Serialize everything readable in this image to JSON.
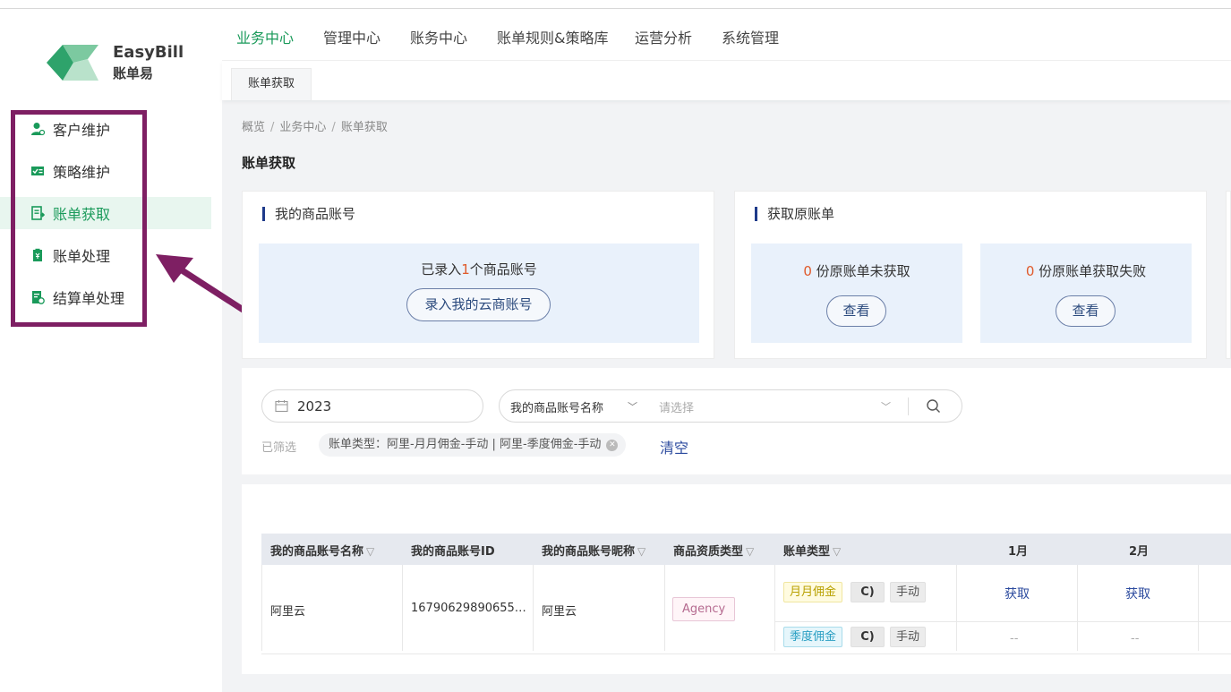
{
  "brand": {
    "name_en": "EasyBill",
    "name_cn": "账单易",
    "accent": "#1a9a5a",
    "highlight": "#7e1f63"
  },
  "sidebar": {
    "items": [
      {
        "label": "客户维护",
        "icon": "user-icon"
      },
      {
        "label": "策略维护",
        "icon": "strategy-icon"
      },
      {
        "label": "账单获取",
        "icon": "bill-fetch-icon",
        "active": true
      },
      {
        "label": "账单处理",
        "icon": "bill-process-icon"
      },
      {
        "label": "结算单处理",
        "icon": "settlement-icon"
      }
    ]
  },
  "topnav": {
    "items": [
      "业务中心",
      "管理中心",
      "账务中心",
      "账单规则&策略库",
      "运营分析",
      "系统管理"
    ],
    "active": 0
  },
  "tabs": [
    "账单获取"
  ],
  "breadcrumb": [
    "概览",
    "业务中心",
    "账单获取"
  ],
  "breadcrumb_sep": "/",
  "page_title": "账单获取",
  "cards": {
    "accounts": {
      "title": "我的商品账号",
      "text_pre": "已录入",
      "count": "1",
      "text_post": "个商品账号",
      "button": "录入我的云商账号"
    },
    "raw_bills": {
      "title": "获取原账单",
      "not_fetched_count": "0",
      "not_fetched_text": " 份原账单未获取",
      "failed_count": "0",
      "failed_text": " 份原账单获取失败",
      "view_button": "查看"
    }
  },
  "filter": {
    "year": "2023",
    "account_select": "我的商品账号名称",
    "placeholder": "请选择",
    "filtered_label": "已筛选",
    "tag": "账单类型：阿里-月月佣金-手动 | 阿里-季度佣金-手动",
    "clear": "清空"
  },
  "table": {
    "columns": [
      "我的商品账号名称",
      "我的商品账号ID",
      "我的商品账号昵称",
      "商品资质类型",
      "账单类型",
      "1月",
      "2月"
    ],
    "filter_icon": "▽",
    "rows": [
      {
        "name": "阿里云",
        "id": "16790629890655…",
        "nickname": "阿里云",
        "type": "Agency",
        "bills": [
          {
            "type": "月月佣金",
            "link": "C)",
            "mode": "手动",
            "jan": "获取",
            "feb": "获取"
          },
          {
            "type": "季度佣金",
            "link": "C)",
            "mode": "手动",
            "jan": "--",
            "feb": "--"
          }
        ]
      }
    ]
  }
}
